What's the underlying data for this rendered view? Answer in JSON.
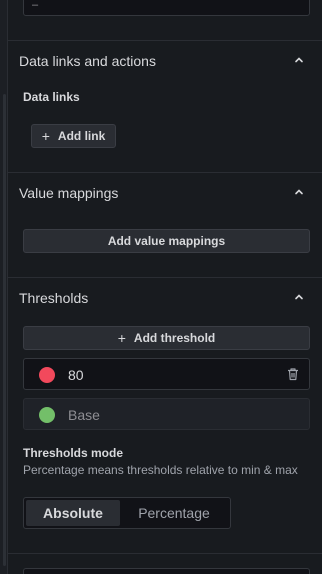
{
  "sections": {
    "data_links": {
      "title": "Data links and actions",
      "sub_label": "Data links",
      "add_button": "Add link"
    },
    "value_mappings": {
      "title": "Value mappings",
      "add_button": "Add value mappings"
    },
    "thresholds": {
      "title": "Thresholds",
      "add_button": "Add threshold",
      "items": [
        {
          "value": "80",
          "color": "#f2495c"
        },
        {
          "value": "Base",
          "color": "#73bf69"
        }
      ],
      "mode": {
        "label": "Thresholds mode",
        "description": "Percentage means thresholds relative to min & max",
        "options": [
          "Absolute",
          "Percentage"
        ],
        "selected": "Absolute"
      }
    }
  },
  "icons": {
    "collapse": "chevron-up-icon",
    "add": "plus-icon",
    "delete": "trash-icon"
  }
}
